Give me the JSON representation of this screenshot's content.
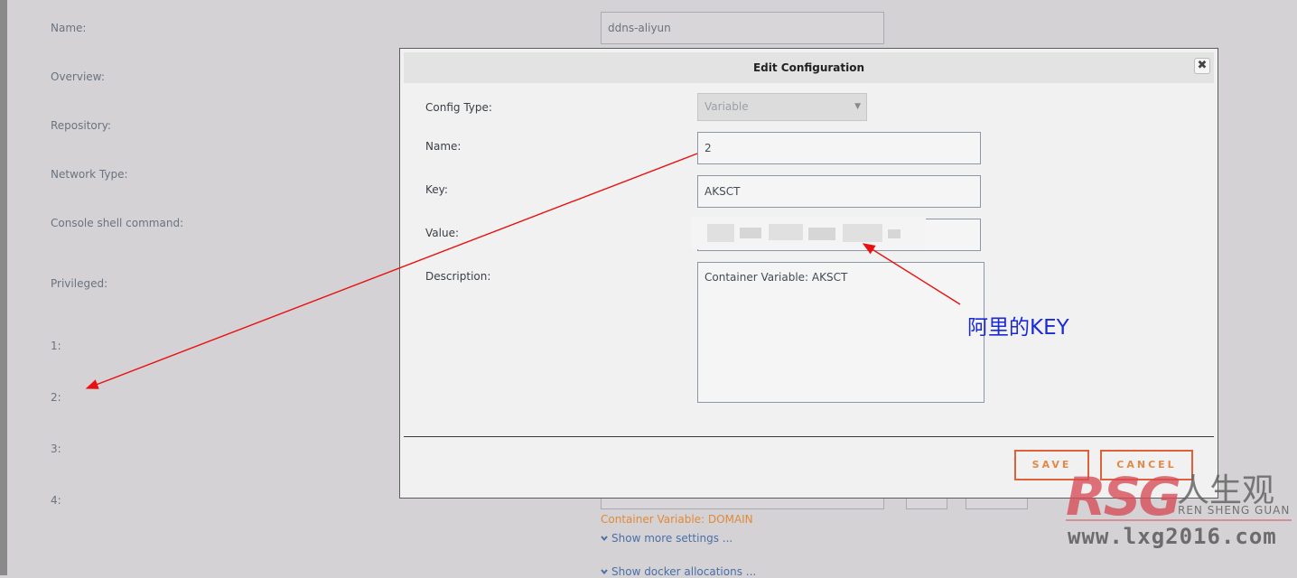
{
  "background_form": {
    "labels": [
      "Name:",
      "Overview:",
      "Repository:",
      "Network Type:",
      "Console shell command:",
      "Privileged:",
      "1:",
      "2:",
      "3:",
      "4:"
    ],
    "name_value": "ddns-aliyun",
    "hint": "Container Variable: DOMAIN",
    "show_more": "Show more settings ...",
    "show_docker": "Show docker allocations ..."
  },
  "modal": {
    "title": "Edit Configuration",
    "close_icon": "close-icon",
    "config_type_label": "Config Type:",
    "config_type_value": "Variable",
    "name_label": "Name:",
    "name_value": "2",
    "key_label": "Key:",
    "key_value": "AKSCT",
    "value_label": "Value:",
    "description_label": "Description:",
    "description_value": "Container Variable: AKSCT",
    "save_label": "SAVE",
    "cancel_label": "CANCEL"
  },
  "annotation": {
    "text": "阿里的KEY",
    "color": "#1a2bd6",
    "arrow_color": "#e81010"
  },
  "watermark": {
    "brand": "RSG",
    "cn_text": "人生观",
    "pinyin": "REN SHENG GUAN",
    "url": "www.lxg2016.com"
  },
  "colors": {
    "accent": "#e0603a",
    "hint": "#e08a3a",
    "link": "#4b6fa8"
  }
}
